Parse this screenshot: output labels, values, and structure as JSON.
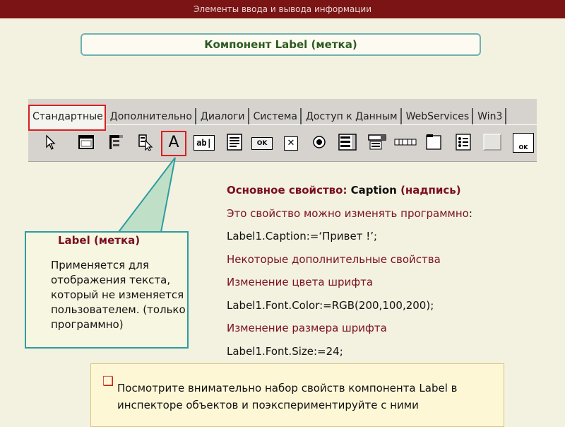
{
  "header": {
    "text": "Элементы ввода и вывода информации"
  },
  "title": {
    "text": "Компонент Label (метка)"
  },
  "palette": {
    "tabs": [
      "Стандартные",
      "Дополнительно",
      "Диалоги",
      "Система",
      "Доступ к Данным",
      "WebServices",
      "Win3"
    ],
    "active_tab": "Стандартные",
    "tools": [
      {
        "icon": "pointer-icon"
      },
      {
        "icon": "frame-icon"
      },
      {
        "icon": "main-menu-icon"
      },
      {
        "icon": "popup-menu-icon"
      },
      {
        "icon": "label-icon",
        "glyph": "A"
      },
      {
        "icon": "edit-icon",
        "glyph": "ab|"
      },
      {
        "icon": "memo-icon"
      },
      {
        "icon": "button-icon",
        "glyph": "OK"
      },
      {
        "icon": "checkbox-icon",
        "glyph": "✕"
      },
      {
        "icon": "radiobutton-icon"
      },
      {
        "icon": "listbox-icon"
      },
      {
        "icon": "combobox-icon"
      },
      {
        "icon": "scrollbar-icon"
      },
      {
        "icon": "groupbox-icon"
      },
      {
        "icon": "radiogroup-icon"
      },
      {
        "icon": "panel-icon"
      },
      {
        "icon": "actionlist-icon",
        "glyph": "OK"
      }
    ]
  },
  "properties": {
    "main_prop_prefix": "Основное свойство: ",
    "main_prop_name": "Caption",
    "main_prop_suffix": " (надпись)",
    "change_text": "Это свойство можно изменять программно",
    "change_colon": ":",
    "code1": "Label1.Caption:=‘Привет !’;",
    "additional": "Некоторые дополнительные свойства",
    "color_change": "Изменение цвета шрифта",
    "code2": "Label1.Font.Color:=RGB(200,100,200);",
    "size_change": "Изменение размера шрифта",
    "code3": "Label1.Font.Size:=24;"
  },
  "callout": {
    "title": "Label (метка)",
    "body": " Применяется для отображения текста, который не изменяется пользователем. (только программно)"
  },
  "note": {
    "bullet": "❑",
    "text": "Посмотрите внимательно набор свойств компонента Label в инспекторе объектов и поэкспериментируйте с ними"
  },
  "colors": {
    "header_bg": "#7b1414",
    "accent_red": "#7a0f24",
    "highlight_red": "#d82020",
    "teal": "#2e9ca0",
    "page_bg": "#f3f1df"
  }
}
